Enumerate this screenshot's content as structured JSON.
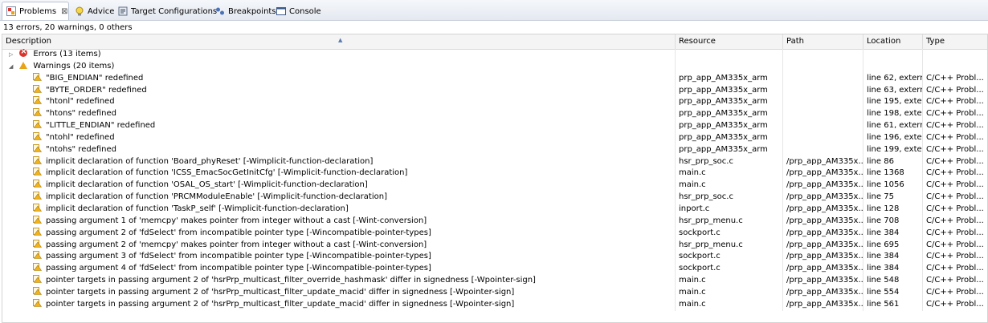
{
  "tabs": [
    {
      "label": "Problems",
      "icon": "problems-icon"
    },
    {
      "label": "Advice",
      "icon": "lightbulb-icon"
    },
    {
      "label": "Target Configurations",
      "icon": "target-config-icon"
    },
    {
      "label": "Breakpoints",
      "icon": "breakpoints-icon"
    },
    {
      "label": "Console",
      "icon": "console-icon"
    }
  ],
  "summary": "13 errors, 20 warnings, 0 others",
  "columns": [
    "Description",
    "Resource",
    "Path",
    "Location",
    "Type"
  ],
  "groups": {
    "errors": "Errors (13 items)",
    "warnings": "Warnings (20 items)"
  },
  "rows": [
    {
      "desc": "\"BIG_ENDIAN\" redefined",
      "resource": "prp_app_AM335x_arm",
      "path": "",
      "location": "line 62, extern...",
      "type": "C/C++ Probl..."
    },
    {
      "desc": "\"BYTE_ORDER\" redefined",
      "resource": "prp_app_AM335x_arm",
      "path": "",
      "location": "line 63, extern...",
      "type": "C/C++ Probl..."
    },
    {
      "desc": "\"htonl\" redefined",
      "resource": "prp_app_AM335x_arm",
      "path": "",
      "location": "line 195, exter...",
      "type": "C/C++ Probl..."
    },
    {
      "desc": "\"htons\" redefined",
      "resource": "prp_app_AM335x_arm",
      "path": "",
      "location": "line 198, exter...",
      "type": "C/C++ Probl..."
    },
    {
      "desc": "\"LITTLE_ENDIAN\" redefined",
      "resource": "prp_app_AM335x_arm",
      "path": "",
      "location": "line 61, extern...",
      "type": "C/C++ Probl..."
    },
    {
      "desc": "\"ntohl\" redefined",
      "resource": "prp_app_AM335x_arm",
      "path": "",
      "location": "line 196, exter...",
      "type": "C/C++ Probl..."
    },
    {
      "desc": "\"ntohs\" redefined",
      "resource": "prp_app_AM335x_arm",
      "path": "",
      "location": "line 199, exter...",
      "type": "C/C++ Probl..."
    },
    {
      "desc": "implicit declaration of function 'Board_phyReset' [-Wimplicit-function-declaration]",
      "resource": "hsr_prp_soc.c",
      "path": "/prp_app_AM335x...",
      "location": "line 86",
      "type": "C/C++ Probl..."
    },
    {
      "desc": "implicit declaration of function 'ICSS_EmacSocGetInitCfg' [-Wimplicit-function-declaration]",
      "resource": "main.c",
      "path": "/prp_app_AM335x...",
      "location": "line 1368",
      "type": "C/C++ Probl..."
    },
    {
      "desc": "implicit declaration of function 'OSAL_OS_start' [-Wimplicit-function-declaration]",
      "resource": "main.c",
      "path": "/prp_app_AM335x...",
      "location": "line 1056",
      "type": "C/C++ Probl..."
    },
    {
      "desc": "implicit declaration of function 'PRCMModuleEnable' [-Wimplicit-function-declaration]",
      "resource": "hsr_prp_soc.c",
      "path": "/prp_app_AM335x...",
      "location": "line 75",
      "type": "C/C++ Probl..."
    },
    {
      "desc": "implicit declaration of function 'TaskP_self' [-Wimplicit-function-declaration]",
      "resource": "inport.c",
      "path": "/prp_app_AM335x...",
      "location": "line 128",
      "type": "C/C++ Probl..."
    },
    {
      "desc": "passing argument 1 of 'memcpy' makes pointer from integer without a cast [-Wint-conversion]",
      "resource": "hsr_prp_menu.c",
      "path": "/prp_app_AM335x...",
      "location": "line 708",
      "type": "C/C++ Probl..."
    },
    {
      "desc": "passing argument 2 of 'fdSelect' from incompatible pointer type [-Wincompatible-pointer-types]",
      "resource": "sockport.c",
      "path": "/prp_app_AM335x...",
      "location": "line 384",
      "type": "C/C++ Probl..."
    },
    {
      "desc": "passing argument 2 of 'memcpy' makes pointer from integer without a cast [-Wint-conversion]",
      "resource": "hsr_prp_menu.c",
      "path": "/prp_app_AM335x...",
      "location": "line 695",
      "type": "C/C++ Probl..."
    },
    {
      "desc": "passing argument 3 of 'fdSelect' from incompatible pointer type [-Wincompatible-pointer-types]",
      "resource": "sockport.c",
      "path": "/prp_app_AM335x...",
      "location": "line 384",
      "type": "C/C++ Probl..."
    },
    {
      "desc": "passing argument 4 of 'fdSelect' from incompatible pointer type [-Wincompatible-pointer-types]",
      "resource": "sockport.c",
      "path": "/prp_app_AM335x...",
      "location": "line 384",
      "type": "C/C++ Probl..."
    },
    {
      "desc": "pointer targets in passing argument 2 of 'hsrPrp_multicast_filter_override_hashmask' differ in signedness [-Wpointer-sign]",
      "resource": "main.c",
      "path": "/prp_app_AM335x...",
      "location": "line 548",
      "type": "C/C++ Probl..."
    },
    {
      "desc": "pointer targets in passing argument 2 of 'hsrPrp_multicast_filter_update_macid' differ in signedness [-Wpointer-sign]",
      "resource": "main.c",
      "path": "/prp_app_AM335x...",
      "location": "line 554",
      "type": "C/C++ Probl..."
    },
    {
      "desc": "pointer targets in passing argument 2 of 'hsrPrp_multicast_filter_update_macid' differ in signedness [-Wpointer-sign]",
      "resource": "main.c",
      "path": "/prp_app_AM335x...",
      "location": "line 561",
      "type": "C/C++ Probl..."
    }
  ]
}
